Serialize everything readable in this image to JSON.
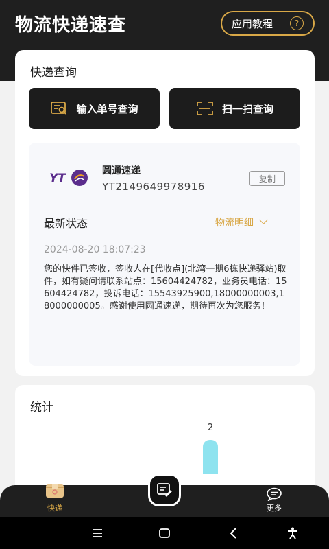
{
  "header": {
    "title": "物流快递速查",
    "tutorial_label": "应用教程",
    "help_glyph": "?"
  },
  "query": {
    "section_title": "快递查询",
    "input_button": "输入单号查询",
    "scan_button": "扫一扫查询"
  },
  "result": {
    "logo_text": "YT",
    "carrier": "圆通速递",
    "tracking_number": "YT2149649978916",
    "copy_label": "复制",
    "status_label": "最新状态",
    "detail_link": "物流明细",
    "timestamp": "2024-08-20 18:07:23",
    "message": "您的快件已签收，签收人在[代收点](北湾一期6栋快递驿站)取件，如有疑问请联系站点：15604424782，业务员电话：15604424782，投诉电话：15543925900,18000000003,18000000005。感谢使用圆通速递，期待再次为您服务！"
  },
  "stats": {
    "title": "统计",
    "bar_value": "2"
  },
  "tabbar": {
    "express_label": "快递",
    "more_label": "更多"
  },
  "colors": {
    "accent": "#d9a847",
    "dark": "#1f1f1f",
    "bar": "#8ee3ef"
  }
}
